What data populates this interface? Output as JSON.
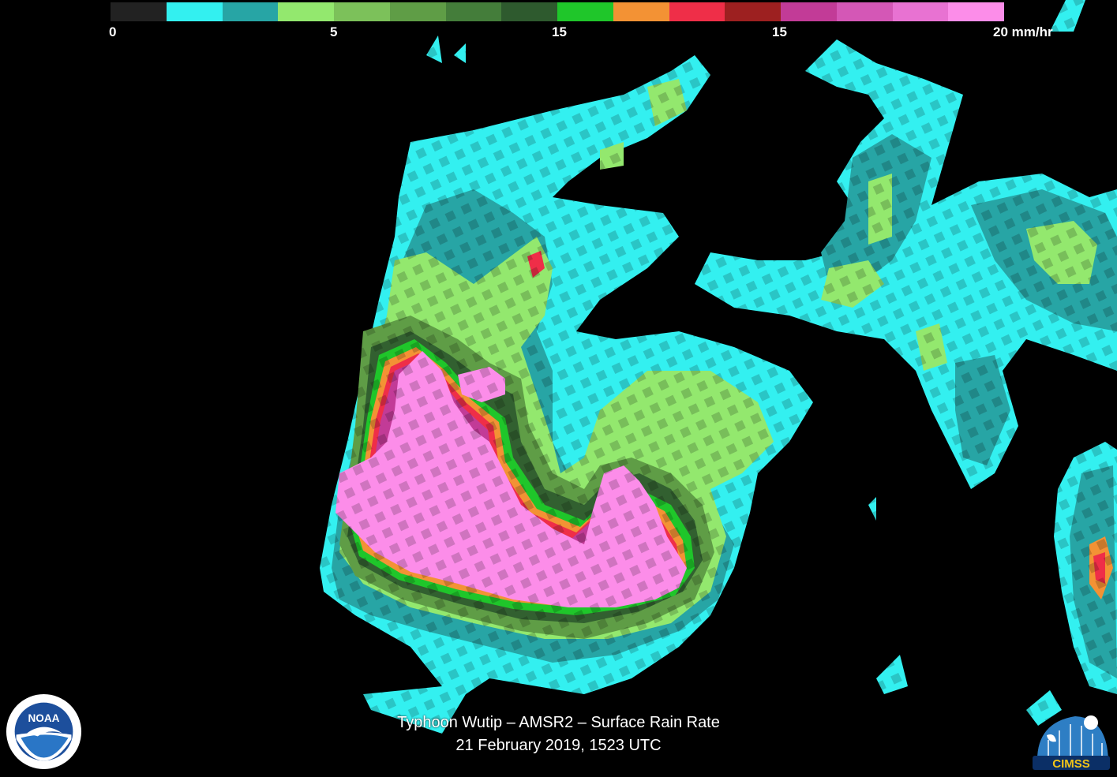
{
  "legend": {
    "colors": [
      "#222222",
      "#33f0f0",
      "#27a5a5",
      "#93e86e",
      "#7cc15a",
      "#5f9d46",
      "#447d3a",
      "#2e5a2e",
      "#1fc62a",
      "#f39234",
      "#ef2e48",
      "#9d2020",
      "#c23b97",
      "#d457b6",
      "#e872d2",
      "#fc8de9"
    ],
    "tick_labels": [
      "0",
      "5",
      "15",
      "15",
      "20 mm/hr"
    ]
  },
  "caption": {
    "line1": "Typhoon Wutip – AMSR2 – Surface Rain Rate",
    "line2": "21 February 2019, 1523 UTC"
  },
  "logos": {
    "left": {
      "icon": "noaa-logo",
      "text": "NOAA"
    },
    "right": {
      "icon": "cimss-logo",
      "text": "CIMSS"
    }
  }
}
